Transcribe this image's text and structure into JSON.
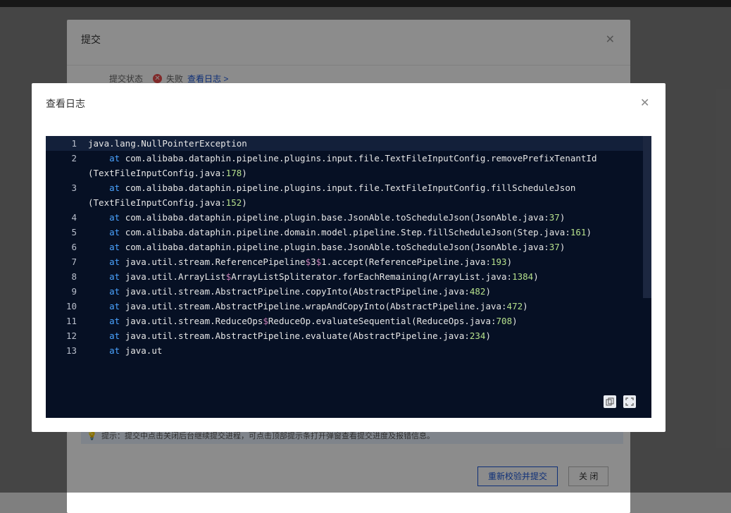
{
  "bg_dialog": {
    "title": "提交",
    "status_label": "提交状态",
    "status_value": "失败",
    "view_log_link": "查看日志 >",
    "hint": "提示：提交中点击关闭后台继续提交进程，可点击顶部提示条打开弹窗查看提交进度及报错信息。",
    "revalidate_button": "重新校验并提交",
    "close_button": "关 闭"
  },
  "log_dialog": {
    "title": "查看日志",
    "close": "X"
  },
  "log": {
    "lines": [
      {
        "n": "1",
        "text": "java.lang.NullPointerException"
      },
      {
        "n": "2",
        "text": "    at com.alibaba.dataphin.pipeline.plugins.input.file.TextFileInputConfig.removePrefixTenantId"
      },
      {
        "n": "",
        "text": "(TextFileInputConfig.java:178)"
      },
      {
        "n": "3",
        "text": "    at com.alibaba.dataphin.pipeline.plugins.input.file.TextFileInputConfig.fillScheduleJson"
      },
      {
        "n": "",
        "text": "(TextFileInputConfig.java:152)"
      },
      {
        "n": "4",
        "text": "    at com.alibaba.dataphin.pipeline.plugin.base.JsonAble.toScheduleJson(JsonAble.java:37)"
      },
      {
        "n": "5",
        "text": "    at com.alibaba.dataphin.pipeline.domain.model.pipeline.Step.fillScheduleJson(Step.java:161)"
      },
      {
        "n": "6",
        "text": "    at com.alibaba.dataphin.pipeline.plugin.base.JsonAble.toScheduleJson(JsonAble.java:37)"
      },
      {
        "n": "7",
        "text": "    at java.util.stream.ReferencePipeline$3$1.accept(ReferencePipeline.java:193)"
      },
      {
        "n": "8",
        "text": "    at java.util.ArrayList$ArrayListSpliterator.forEachRemaining(ArrayList.java:1384)"
      },
      {
        "n": "9",
        "text": "    at java.util.stream.AbstractPipeline.copyInto(AbstractPipeline.java:482)"
      },
      {
        "n": "10",
        "text": "    at java.util.stream.AbstractPipeline.wrapAndCopyInto(AbstractPipeline.java:472)"
      },
      {
        "n": "11",
        "text": "    at java.util.stream.ReduceOps$ReduceOp.evaluateSequential(ReduceOps.java:708)"
      },
      {
        "n": "12",
        "text": "    at java.util.stream.AbstractPipeline.evaluate(AbstractPipeline.java:234)"
      },
      {
        "n": "13",
        "text": "    at java.ut"
      }
    ]
  },
  "icons": {
    "copy": "copy-icon",
    "fullscreen": "fullscreen-icon",
    "close": "close-icon",
    "error": "error-icon",
    "info": "bulb-icon"
  }
}
